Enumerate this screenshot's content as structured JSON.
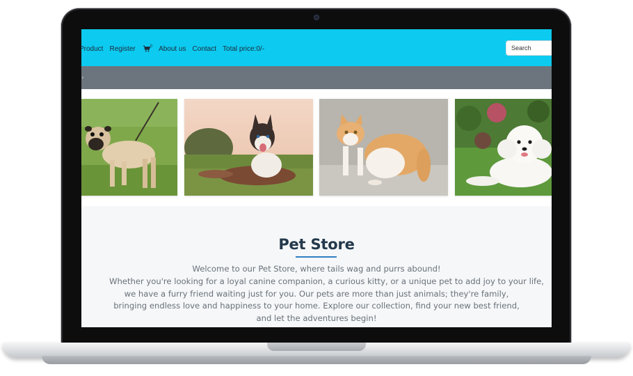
{
  "navbar": {
    "items": [
      "Product",
      "Register",
      "About us",
      "Contact"
    ],
    "cart_count": "0",
    "total_price": "Total price:0/-",
    "search_placeholder": "Search"
  },
  "colors": {
    "navbar": "#0dcaf0",
    "subbar": "#6c757d",
    "title": "#23384b",
    "accent_underline": "#2f7fc1"
  },
  "gallery": {
    "items": [
      "pug",
      "husky",
      "cat",
      "poodle"
    ]
  },
  "about": {
    "title": "Pet Store",
    "lines": [
      "Welcome to our Pet Store, where tails wag and purrs abound!",
      "Whether you're looking for a loyal canine companion, a curious kitty, or a unique pet to add joy to your life,",
      "we have a furry friend waiting just for you. Our pets are more than just animals; they're family,",
      "bringing endless love and happiness to your home. Explore our collection, find your new best friend,",
      "and let the adventures begin!"
    ]
  }
}
